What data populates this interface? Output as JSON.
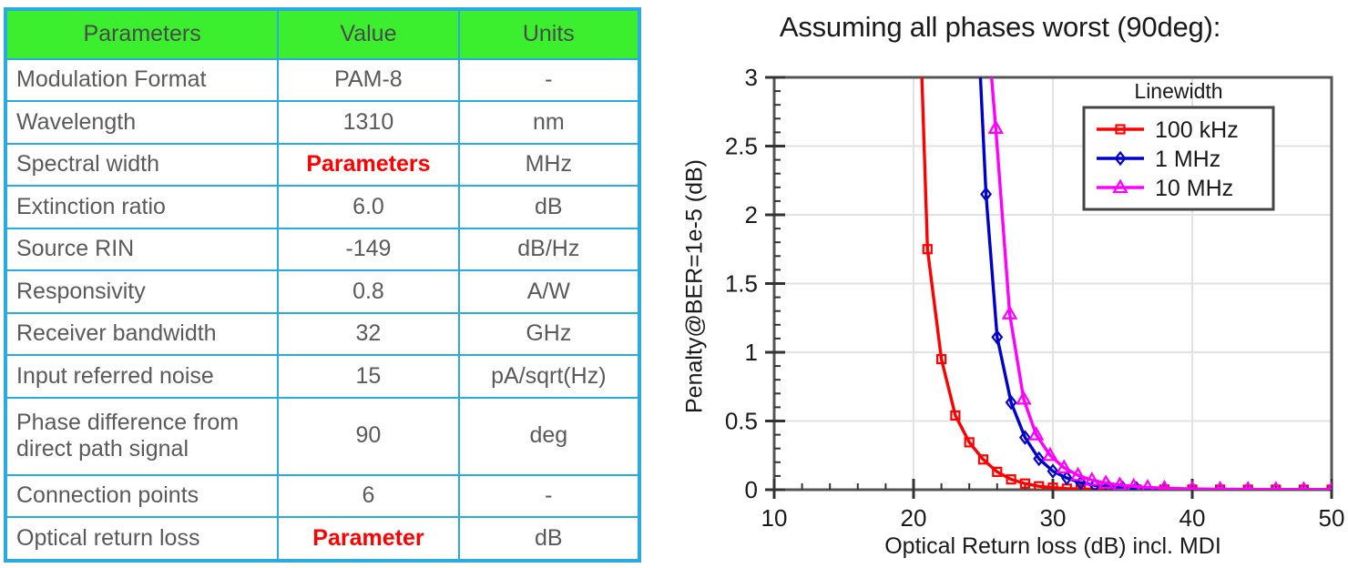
{
  "table": {
    "headers": [
      "Parameters",
      "Value",
      "Units"
    ],
    "rows": [
      {
        "parameter": "Modulation Format",
        "value": "PAM-8",
        "units": "-",
        "highlight": false
      },
      {
        "parameter": "Wavelength",
        "value": "1310",
        "units": "nm",
        "highlight": false
      },
      {
        "parameter": "Spectral width",
        "value": "Parameters",
        "units": "MHz",
        "highlight": true
      },
      {
        "parameter": "Extinction ratio",
        "value": "6.0",
        "units": "dB",
        "highlight": false
      },
      {
        "parameter": "Source RIN",
        "value": "-149",
        "units": "dB/Hz",
        "highlight": false
      },
      {
        "parameter": "Responsivity",
        "value": "0.8",
        "units": "A/W",
        "highlight": false
      },
      {
        "parameter": "Receiver bandwidth",
        "value": "32",
        "units": "GHz",
        "highlight": false
      },
      {
        "parameter": "Input referred noise",
        "value": "15",
        "units": "pA/sqrt(Hz)",
        "highlight": false
      },
      {
        "parameter": "Phase difference from direct path signal",
        "value": "90",
        "units": "deg",
        "highlight": false
      },
      {
        "parameter": "Connection points",
        "value": "6",
        "units": "-",
        "highlight": false
      },
      {
        "parameter": "Optical return loss",
        "value": "Parameter",
        "units": "dB",
        "highlight": true
      }
    ],
    "header_color": "#3BEE2E",
    "border_color": "#29ABE2",
    "highlight_color": "#FF0000"
  },
  "chart_data": {
    "type": "line",
    "title": "Assuming all phases worst (90deg):",
    "xlabel": "Optical Return loss (dB) incl. MDI",
    "ylabel": "Penalty@BER=1e-5 (dB)",
    "xlim": [
      10,
      50
    ],
    "ylim": [
      0,
      3
    ],
    "xticks": [
      10,
      20,
      30,
      40,
      50
    ],
    "yticks": [
      0,
      0.5,
      1,
      1.5,
      2,
      2.5,
      3
    ],
    "grid": true,
    "legend_title": "Linewidth",
    "legend_position": "top-right",
    "series": [
      {
        "name": "100 kHz",
        "color": "#FF0000",
        "marker": "square",
        "points": [
          [
            20.6,
            3.0
          ],
          [
            21.0,
            1.75
          ],
          [
            22.0,
            0.95
          ],
          [
            23.0,
            0.54
          ],
          [
            24.0,
            0.345
          ],
          [
            25.0,
            0.22
          ],
          [
            26.0,
            0.13
          ],
          [
            27.0,
            0.075
          ],
          [
            28.0,
            0.045
          ],
          [
            29.0,
            0.025
          ],
          [
            30.0,
            0.015
          ],
          [
            31.0,
            0.008
          ],
          [
            32.0,
            0.005
          ],
          [
            34.0,
            0.003
          ],
          [
            36.0,
            0.002
          ],
          [
            38.0,
            0.0015
          ],
          [
            40.0,
            0.001
          ],
          [
            42.0,
            0.0008
          ],
          [
            44.0,
            0.0006
          ],
          [
            46.0,
            0.0004
          ],
          [
            48.0,
            0.0003
          ],
          [
            50.0,
            0.0002
          ]
        ]
      },
      {
        "name": "1 MHz",
        "color": "#0000CC",
        "marker": "diamond",
        "points": [
          [
            24.8,
            3.0
          ],
          [
            25.2,
            2.15
          ],
          [
            26.0,
            1.11
          ],
          [
            27.0,
            0.635
          ],
          [
            28.0,
            0.38
          ],
          [
            29.0,
            0.225
          ],
          [
            30.0,
            0.135
          ],
          [
            31.0,
            0.085
          ],
          [
            32.0,
            0.05
          ],
          [
            33.0,
            0.032
          ],
          [
            34.0,
            0.02
          ],
          [
            35.0,
            0.013
          ],
          [
            36.0,
            0.009
          ],
          [
            38.0,
            0.005
          ],
          [
            40.0,
            0.003
          ],
          [
            42.0,
            0.002
          ],
          [
            44.0,
            0.0015
          ],
          [
            46.0,
            0.001
          ],
          [
            48.0,
            0.0007
          ],
          [
            50.0,
            0.0005
          ]
        ]
      },
      {
        "name": "10 MHz",
        "color": "#FF00FF",
        "marker": "triangle",
        "points": [
          [
            25.6,
            3.0
          ],
          [
            25.9,
            2.63
          ],
          [
            26.9,
            1.28
          ],
          [
            27.9,
            0.66
          ],
          [
            28.8,
            0.4
          ],
          [
            29.8,
            0.25
          ],
          [
            30.8,
            0.16
          ],
          [
            31.8,
            0.105
          ],
          [
            32.8,
            0.07
          ],
          [
            33.8,
            0.048
          ],
          [
            34.8,
            0.034
          ],
          [
            35.8,
            0.024
          ],
          [
            36.8,
            0.017
          ],
          [
            38.0,
            0.011
          ],
          [
            40.0,
            0.006
          ],
          [
            42.0,
            0.004
          ],
          [
            44.0,
            0.0025
          ],
          [
            46.0,
            0.0018
          ],
          [
            48.0,
            0.0012
          ],
          [
            50.0,
            0.0008
          ]
        ]
      }
    ]
  }
}
